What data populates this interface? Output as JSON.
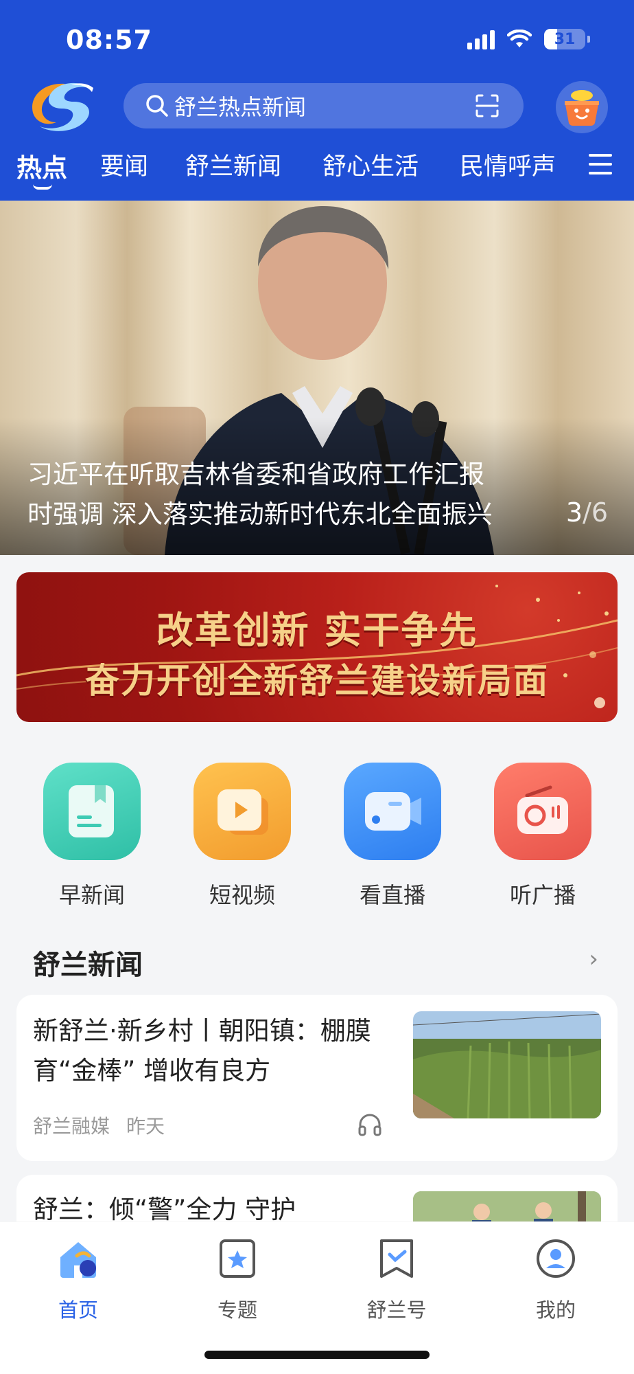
{
  "status_bar": {
    "time": "08:57",
    "battery": "31",
    "battery_level": 0.31
  },
  "header": {
    "search_placeholder": "舒兰热点新闻",
    "tabs": [
      {
        "label": "热点",
        "active": true
      },
      {
        "label": "要闻"
      },
      {
        "label": "舒兰新闻"
      },
      {
        "label": "舒心生活"
      },
      {
        "label": "民情呼声"
      }
    ]
  },
  "hero": {
    "caption_line1": "习近平在听取吉林省委和省政府工作汇报",
    "caption_line2": "时强调 深入落实推动新时代东北全面振兴",
    "page_current": "3",
    "page_total": "/6"
  },
  "banner": {
    "line1": "改革创新 实干争先",
    "line2": "奋力开创全新舒兰建设新局面"
  },
  "shortcuts": [
    {
      "label": "早新闻",
      "icon": "news-note-icon",
      "color": "#3ecbb4"
    },
    {
      "label": "短视频",
      "icon": "video-play-icon",
      "color": "#f6a93b"
    },
    {
      "label": "看直播",
      "icon": "live-camera-icon",
      "color": "#3d8bf2"
    },
    {
      "label": "听广播",
      "icon": "radio-icon",
      "color": "#ef5d55"
    }
  ],
  "section": {
    "title": "舒兰新闻",
    "more": "›"
  },
  "articles": [
    {
      "title": "新舒兰·新乡村丨朝阳镇：棚膜育“金棒” 增收有良方",
      "source": "舒兰融媒",
      "time": "昨天"
    },
    {
      "title": "舒兰：倾“警”全力 守护"
    }
  ],
  "tabbar": [
    {
      "label": "首页",
      "active": true
    },
    {
      "label": "专题"
    },
    {
      "label": "舒兰号"
    },
    {
      "label": "我的"
    }
  ],
  "colors": {
    "primary": "#1f4fd6",
    "tab_active": "#2a62e6",
    "banner_red": "#b9201a",
    "banner_gold": "#f6d189"
  }
}
